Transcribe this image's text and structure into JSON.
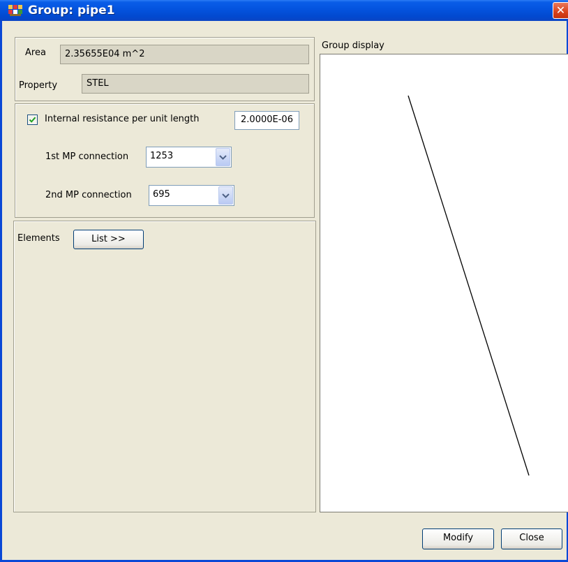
{
  "window": {
    "title": "Group: pipe1",
    "close_symbol": "✕"
  },
  "properties": {
    "area_label": "Area",
    "area_value": "2.35655E04 m^2",
    "property_label": "Property",
    "property_value": "STEL"
  },
  "resistance": {
    "checkbox_checked": true,
    "label": "Internal resistance per unit length",
    "value": "2.0000E-06",
    "mp1_label": "1st MP connection",
    "mp1_value": "1253",
    "mp2_label": "2nd MP connection",
    "mp2_value": "695"
  },
  "elements": {
    "label": "Elements",
    "list_button": "List >>"
  },
  "display": {
    "title": "Group display"
  },
  "footer": {
    "modify_button": "Modify",
    "close_button": "Close"
  },
  "colors": {
    "titlebar": "#0455e0",
    "close_button": "#d9421c",
    "dialog_bg": "#ece9d8",
    "checkmark": "#21a121"
  }
}
